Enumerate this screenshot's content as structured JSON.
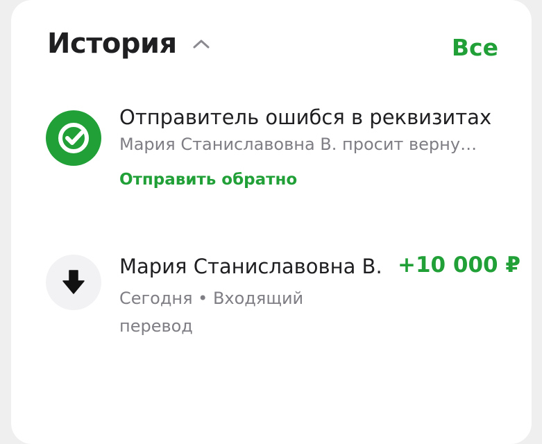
{
  "history": {
    "title": "История",
    "all_link": "Все"
  },
  "items": [
    {
      "icon": "sber-check-icon",
      "title": "Отправитель ошибся в реквизитах",
      "subtitle": "Мария Станиславовна В. просит верну…",
      "action": "Отправить обратно",
      "accent_color": "#21A038"
    },
    {
      "icon": "arrow-down-icon",
      "name": "Мария Станиславовна В.",
      "amount": "+10 000 ₽",
      "meta": "Сегодня • Входящий перевод"
    }
  ]
}
